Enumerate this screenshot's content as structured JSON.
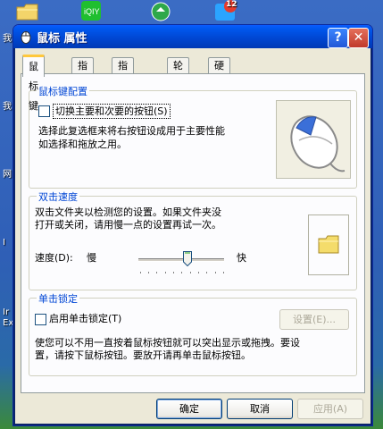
{
  "window": {
    "title": "鼠标 属性"
  },
  "tabs": [
    {
      "label": "鼠标键",
      "active": true
    },
    {
      "label": "指针",
      "active": false
    },
    {
      "label": "指针选项",
      "active": false
    },
    {
      "label": "轮",
      "active": false
    },
    {
      "label": "硬件",
      "active": false
    }
  ],
  "button_config": {
    "title": "鼠标键配置",
    "checkbox_label": "切换主要和次要的按钮(S)",
    "checkbox_checked": false,
    "description_1": "选择此复选框来将右按钮设成用于主要性能",
    "description_2": "如选择和拖放之用。"
  },
  "double_click": {
    "title": "双击速度",
    "description_1": "双击文件夹以检测您的设置。如果文件夹没",
    "description_2": "打开或关闭，请用慢一点的设置再试一次。",
    "speed_label": "速度(D):",
    "slow_label": "慢",
    "fast_label": "快",
    "speed_level_fraction": 0.56
  },
  "click_lock": {
    "title": "单击锁定",
    "checkbox_label": "启用单击锁定(T)",
    "checkbox_checked": false,
    "settings_label": "设置(E)...",
    "description_1": "使您可以不用一直按着鼠标按钮就可以突出显示或拖拽。要设",
    "description_2": "置，请按下鼠标按钮。要放开请再单击鼠标按钮。"
  },
  "footer": {
    "ok_label": "确定",
    "cancel_label": "取消",
    "apply_label": "应用(A)"
  },
  "desktop": {
    "badge_count": "12",
    "side_labels": [
      "我",
      "我",
      "网",
      "I",
      "Ir",
      "Ex"
    ]
  },
  "icons": {
    "help": "help-icon",
    "close": "close-icon",
    "mouse": "mouse-illustration-icon",
    "folder": "folder-icon"
  },
  "colors": {
    "title_bar": "#0047d3",
    "group_title": "#0046d5",
    "active_tab_highlight": "#ffc83c"
  }
}
